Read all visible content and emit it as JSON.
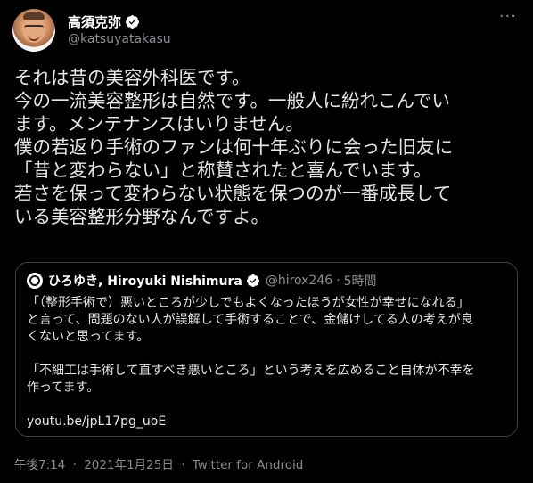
{
  "author": {
    "name": "高須克弥",
    "handle": "@katsuyatakasu"
  },
  "tweet": {
    "lines": [
      "それは昔の美容外科医です。",
      "今の一流美容整形は自然です。一般人に紛れこんでい",
      "ます。メンテナンスはいりません。",
      "僕の若返り手術のファンは何十年ぶりに会った旧友に",
      "「昔と変わらない」と称賛されたと喜んでいます。",
      "若さを保って変わらない状態を保つのが一番成長して",
      "いる美容整形分野なんですよ。"
    ]
  },
  "quote": {
    "name": "ひろゆき, Hiroyuki Nishimura",
    "handle": "@hirox246",
    "separator": "·",
    "time": "5時間",
    "lines": [
      "「（整形手術で）悪いところが少しでもよくなったほうが女性が幸せになれる」",
      "と言って、問題のない人が誤解して手術することで、金儲けしてる人の考えが良",
      "くないと思ってます。",
      "",
      "「不細工は手術して直すべき悪いところ」という考えを広めること自体が不幸を",
      "作ってます。",
      "",
      "youtu.be/jpL17pg_uoE"
    ]
  },
  "meta": {
    "time": "午後7:14",
    "date": "2021年1月25日",
    "source": "Twitter for Android",
    "separator": "·"
  },
  "icons": {
    "verified": "verified-badge-icon",
    "more": "more-options-icon"
  },
  "colors": {
    "background": "#000000",
    "text": "#e6e6e6",
    "muted": "#8a8d91",
    "border": "#3d4147"
  }
}
